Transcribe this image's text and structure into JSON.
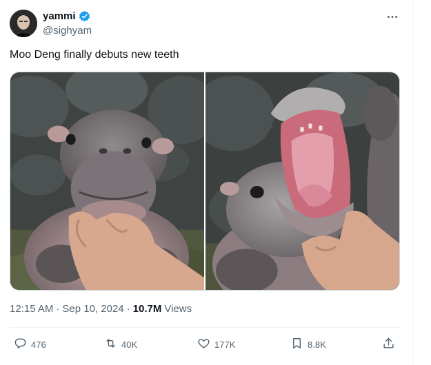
{
  "author": {
    "display_name": "yammi",
    "handle": "@sighyam",
    "verified": true
  },
  "tweet": {
    "text": "Moo Deng finally debuts new teeth"
  },
  "meta": {
    "time": "12:15 AM",
    "separator1": "·",
    "date": "Sep 10, 2024",
    "separator2": "·",
    "views_count": "10.7M",
    "views_label": "Views"
  },
  "actions": {
    "reply_count": "476",
    "retweet_count": "40K",
    "like_count": "177K",
    "bookmark_count": "8.8K"
  },
  "colors": {
    "verified": "#1d9bf0",
    "secondary_text": "#536471",
    "primary_text": "#0f1419",
    "border": "#cfd9de"
  },
  "icons": [
    "verified-badge-icon",
    "more-icon",
    "reply-icon",
    "retweet-icon",
    "like-icon",
    "bookmark-icon",
    "share-icon"
  ]
}
